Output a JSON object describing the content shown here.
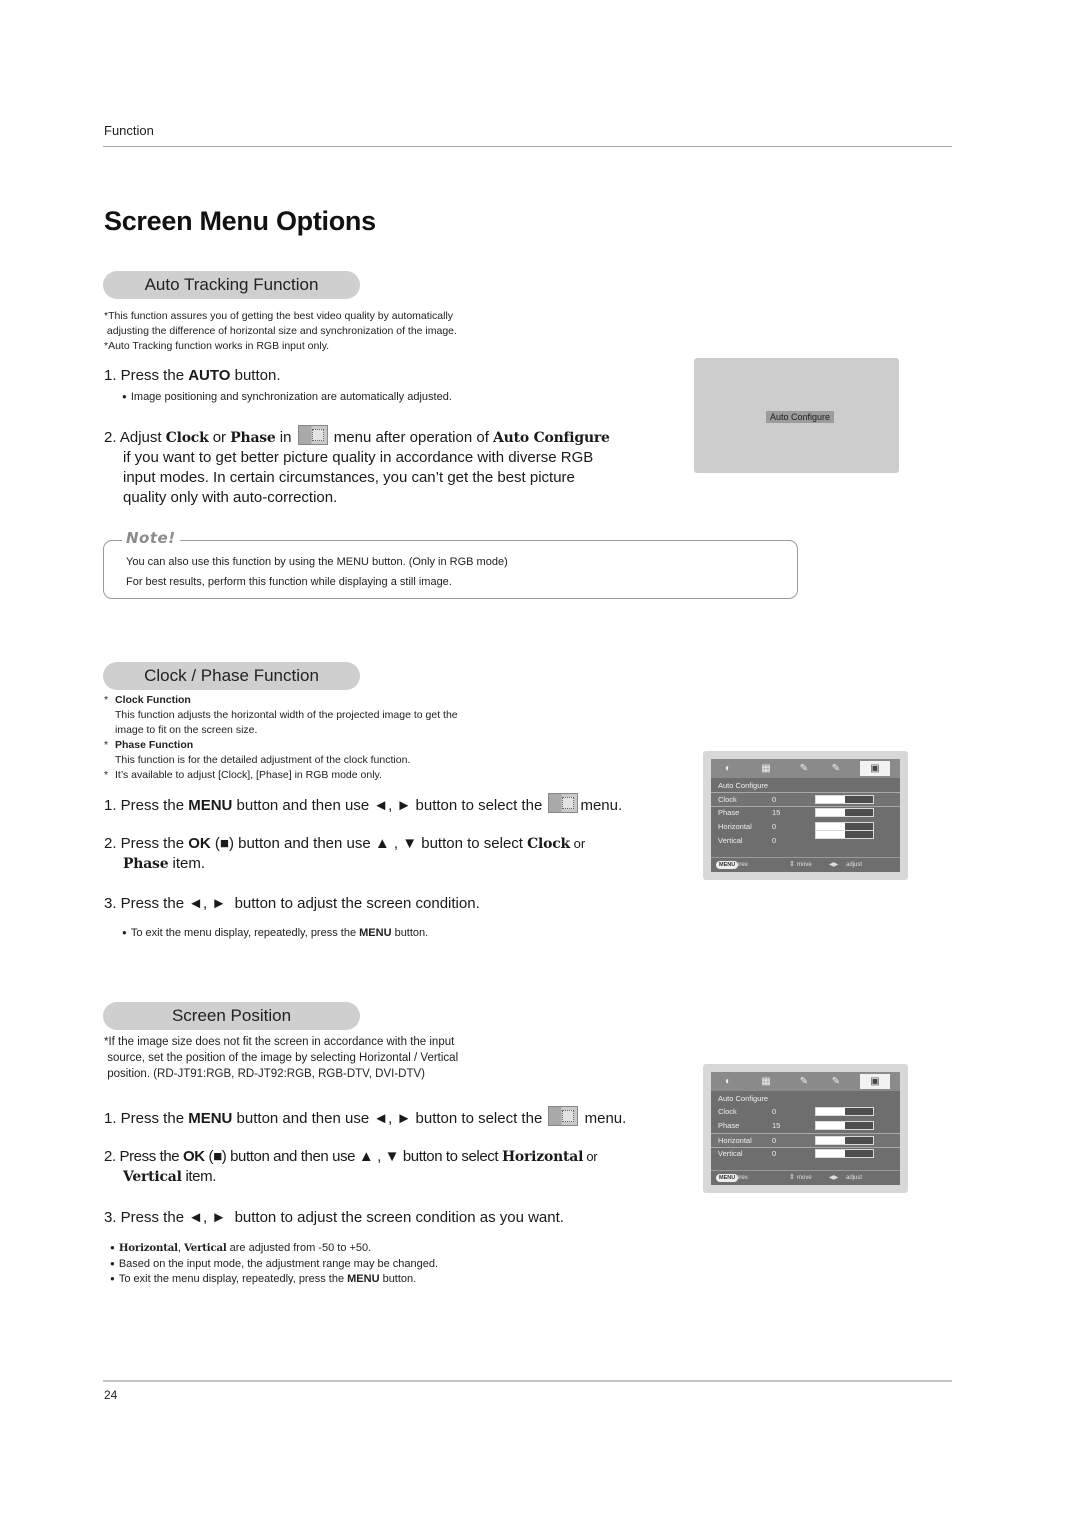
{
  "header": {
    "running_head": "Function",
    "page_title": "Screen Menu Options"
  },
  "auto_tracking": {
    "heading": "Auto Tracking Function",
    "intro": [
      "*This function assures you of getting the best video quality by automatically",
      " adjusting the difference of horizontal size and synchronization of the image.",
      "*Auto Tracking function works in RGB input only."
    ],
    "step1": {
      "prefix": "1. Press the ",
      "bold": "AUTO",
      "suffix": " button."
    },
    "step1_bullet": "Image positioning and synchronization are automatically adjusted.",
    "step2": {
      "p1": "2. Adjust ",
      "clock": "Clock",
      "or": " or ",
      "phase": "Phase",
      "in": " in ",
      "after": " menu after operation of ",
      "auto_configure": "Auto Configure",
      "line2": "if you want to get better picture quality in accordance with diverse RGB",
      "line3": "input modes. In certain circumstances, you can’t get the best picture",
      "line4": "quality only with auto-correction."
    },
    "screen_label": "Auto Configure"
  },
  "note": {
    "label": "Note!",
    "lines": [
      "You can also use this function by using the MENU button. (Only in RGB mode)",
      "For best results, perform this function while displaying a still image."
    ]
  },
  "clock_phase": {
    "heading": "Clock / Phase Function",
    "clock_title": "Clock Function",
    "clock_desc": [
      "This function adjusts the horizontal width of the projected image to get the",
      "image to fit on the screen size."
    ],
    "phase_title": "Phase Function",
    "phase_desc": "This function is for the detailed adjustment of the clock function.",
    "availability": "It’s available to adjust [Clock], [Phase] in RGB mode only.",
    "star": "*",
    "step1": {
      "prefix": "1. Press the ",
      "bold": "MENU",
      "mid": " button and then use ◄, ► button to select the ",
      "suffix": "menu."
    },
    "step2": {
      "prefix": "2. Press the ",
      "ok": "OK",
      "mid": " (■) button and then use ▲ , ▼ button to select ",
      "item1": "Clock",
      "or": " or",
      "item2": "Phase",
      "suffix": " item."
    },
    "step3": "3. Press the ◄, ►  button to adjust the screen condition.",
    "bullet": {
      "prefix": "To exit the menu display, repeatedly, press the ",
      "bold": "MENU",
      "suffix": " button."
    }
  },
  "screen_position": {
    "heading": "Screen Position",
    "intro": [
      "*If the image size does not fit the screen in accordance with the input",
      " source, set the position of the image by selecting Horizontal / Vertical",
      " position. (RD-JT91:RGB, RD-JT92:RGB, RGB-DTV, DVI-DTV)"
    ],
    "step1": {
      "prefix": "1. Press the ",
      "bold": "MENU",
      "mid": " button and then use ◄, ► button to select the ",
      "suffix": " menu."
    },
    "step2": {
      "prefix": "2. Press the ",
      "ok": "OK",
      "mid": " (■) button and then use ▲ , ▼ button to select ",
      "item1": "Horizontal",
      "or": " or",
      "item2": "Vertical",
      "suffix": " item."
    },
    "step3": "3. Press the ◄, ►  button to adjust the screen condition as you want.",
    "bullets": [
      {
        "b1": "Horizontal",
        "sep": ", ",
        "b2": "Vertical",
        "text": " are adjusted from -50 to +50."
      },
      {
        "text": "Based on the input mode, the adjustment range may be changed."
      },
      {
        "prefix": "To exit the menu display, repeatedly, press the ",
        "bold": "MENU",
        "suffix": " button."
      }
    ]
  },
  "osd_menus": [
    {
      "tabs": [
        "picture-icon",
        "audio-icon",
        "time-icon",
        "special-icon",
        "screen-icon"
      ],
      "active_tab": "screen-icon",
      "title": "Auto Configure",
      "selected_row": "Clock",
      "rows": [
        {
          "label": "Clock",
          "value": "0",
          "level": 0.5
        },
        {
          "label": "Phase",
          "value": "15",
          "level": 0.5
        },
        {
          "label": "Horizontal",
          "value": "0",
          "level": 0.5
        },
        {
          "label": "Vertical",
          "value": "0",
          "level": 0.5
        }
      ],
      "footer": {
        "menu": "MENU",
        "prev": "prev.",
        "move": "move",
        "adjust": "adjust"
      }
    },
    {
      "tabs": [
        "picture-icon",
        "audio-icon",
        "time-icon",
        "special-icon",
        "screen-icon"
      ],
      "active_tab": "screen-icon",
      "title": "Auto Configure",
      "selected_row": "Horizontal",
      "rows": [
        {
          "label": "Clock",
          "value": "0",
          "level": 0.5
        },
        {
          "label": "Phase",
          "value": "15",
          "level": 0.5
        },
        {
          "label": "Horizontal",
          "value": "0",
          "level": 0.5
        },
        {
          "label": "Vertical",
          "value": "0",
          "level": 0.5
        }
      ],
      "footer": {
        "menu": "MENU",
        "prev": "prev.",
        "move": "move",
        "adjust": "adjust"
      }
    }
  ],
  "footer": {
    "page_number": "24"
  }
}
